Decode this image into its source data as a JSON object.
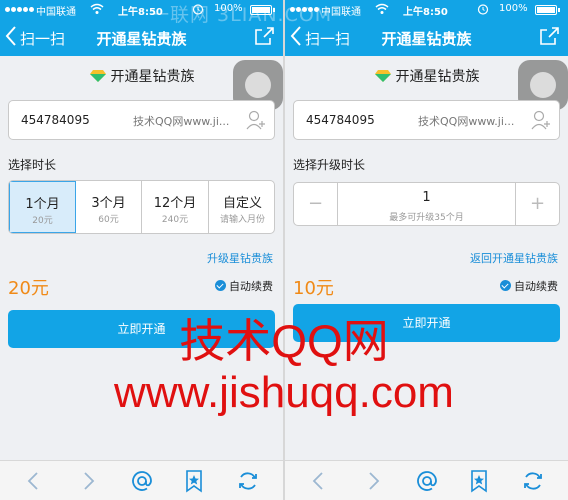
{
  "status": {
    "carrier": "中国联通",
    "time": "上午8:50",
    "battery": "100%"
  },
  "left": {
    "nav": {
      "back_label": "扫一扫",
      "title": "开通星钻贵族"
    },
    "headline": "开通星钻贵族",
    "account": {
      "number": "454784095",
      "site": "技术QQ网www.ji..."
    },
    "section_label": "选择时长",
    "durations": [
      {
        "label": "1个月",
        "price": "20元"
      },
      {
        "label": "3个月",
        "price": "60元"
      },
      {
        "label": "12个月",
        "price": "240元"
      },
      {
        "label": "自定义",
        "price": "请输入月份"
      }
    ],
    "link": "升级星钻贵族",
    "price": "20元",
    "autorenew": "自动续费",
    "button": "立即开通"
  },
  "right": {
    "nav": {
      "back_label": "扫一扫",
      "title": "开通星钻贵族"
    },
    "headline": "开通星钻贵族",
    "account": {
      "number": "454784095",
      "site": "技术QQ网www.ji..."
    },
    "section_label": "选择升级时长",
    "stepper": {
      "value": "1",
      "hint": "最多可升级35个月",
      "minus": "−",
      "plus": "+"
    },
    "link": "返回开通星钻贵族",
    "price": "10元",
    "autorenew": "自动续费",
    "button": "立即开通"
  },
  "watermark": {
    "top": "一联网 3LIAN.COM",
    "line1": "技术QQ网",
    "line2": "www.jishuqq.com"
  },
  "colors": {
    "nav": "#12a4e6",
    "price": "#f08a17",
    "link": "#1a8ed8",
    "watermark": "#e01010"
  },
  "toolbar_icons": [
    "back-arrow-icon",
    "forward-arrow-icon",
    "at-sign-icon",
    "bookmark-star-icon",
    "refresh-icon"
  ]
}
